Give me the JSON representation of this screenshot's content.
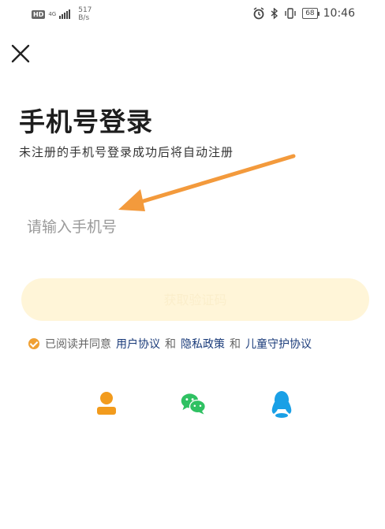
{
  "status_bar": {
    "hd_badge": "HD",
    "network": "4G",
    "speed_value": "517",
    "speed_unit": "B/s",
    "battery": "68",
    "time": "10:46"
  },
  "login": {
    "title": "手机号登录",
    "subtitle": "未注册的手机号登录成功后将自动注册",
    "phone_placeholder": "请输入手机号",
    "phone_value": "",
    "code_button_label": "获取验证码"
  },
  "agreement": {
    "checked": true,
    "prefix": "已阅读并同意",
    "user_agreement": "用户协议",
    "and_1": "和",
    "privacy_policy": "隐私政策",
    "and_2": "和",
    "child_protection": "儿童守护协议"
  },
  "social_login": [
    {
      "name": "account-login",
      "icon": "person-icon",
      "color": "#f29b1d"
    },
    {
      "name": "wechat-login",
      "icon": "wechat-icon",
      "color": "#2fc162"
    },
    {
      "name": "qq-login",
      "icon": "qq-icon",
      "color": "#1aa0e6"
    }
  ],
  "colors": {
    "accent": "#f29b1d",
    "button_bg": "#fff5d8",
    "link": "#1a3b7a",
    "annotation_arrow": "#f39a3c"
  }
}
